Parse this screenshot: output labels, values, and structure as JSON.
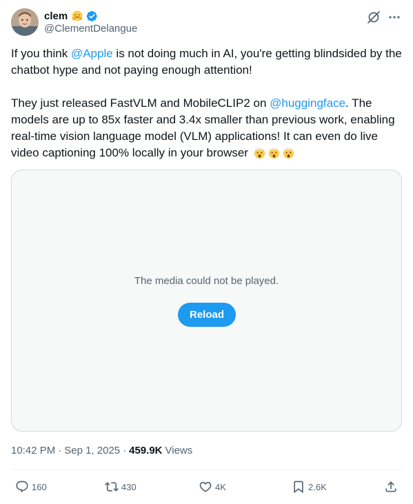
{
  "author": {
    "name": "clem",
    "handle": "@ClementDelangue",
    "name_emoji": "hugging-face-emoji",
    "verified": true,
    "verified_color": "#1d9bf0"
  },
  "tweet": {
    "p1_a": "If you think ",
    "p1_mention": "@Apple",
    "p1_b": " is not doing much in AI, you're getting blindsided by the chatbot hype and not paying enough attention!",
    "p2_a": "They just released FastVLM and MobileCLIP2 on ",
    "p2_mention": "@huggingface",
    "p2_b": ". The models are up to 85x faster and 3.4x smaller than previous work, enabling real-time vision language model (VLM) applications! It can even do live video captioning 100% locally in your browser ",
    "emoji": "mind-blown-emoji"
  },
  "media": {
    "error_message": "The media could not be played.",
    "reload_label": "Reload"
  },
  "meta": {
    "time": "10:42 PM",
    "separator": "·",
    "date": "Sep 1, 2025",
    "views_count": "459.9K",
    "views_label": "Views"
  },
  "actions": {
    "replies": "160",
    "reposts": "430",
    "likes": "4K",
    "bookmarks": "2.6K"
  },
  "colors": {
    "accent": "#1d9bf0",
    "secondary_text": "#536471",
    "primary_text": "#0f1419",
    "border": "#cfd9de",
    "media_bg": "#f7f9f9"
  }
}
